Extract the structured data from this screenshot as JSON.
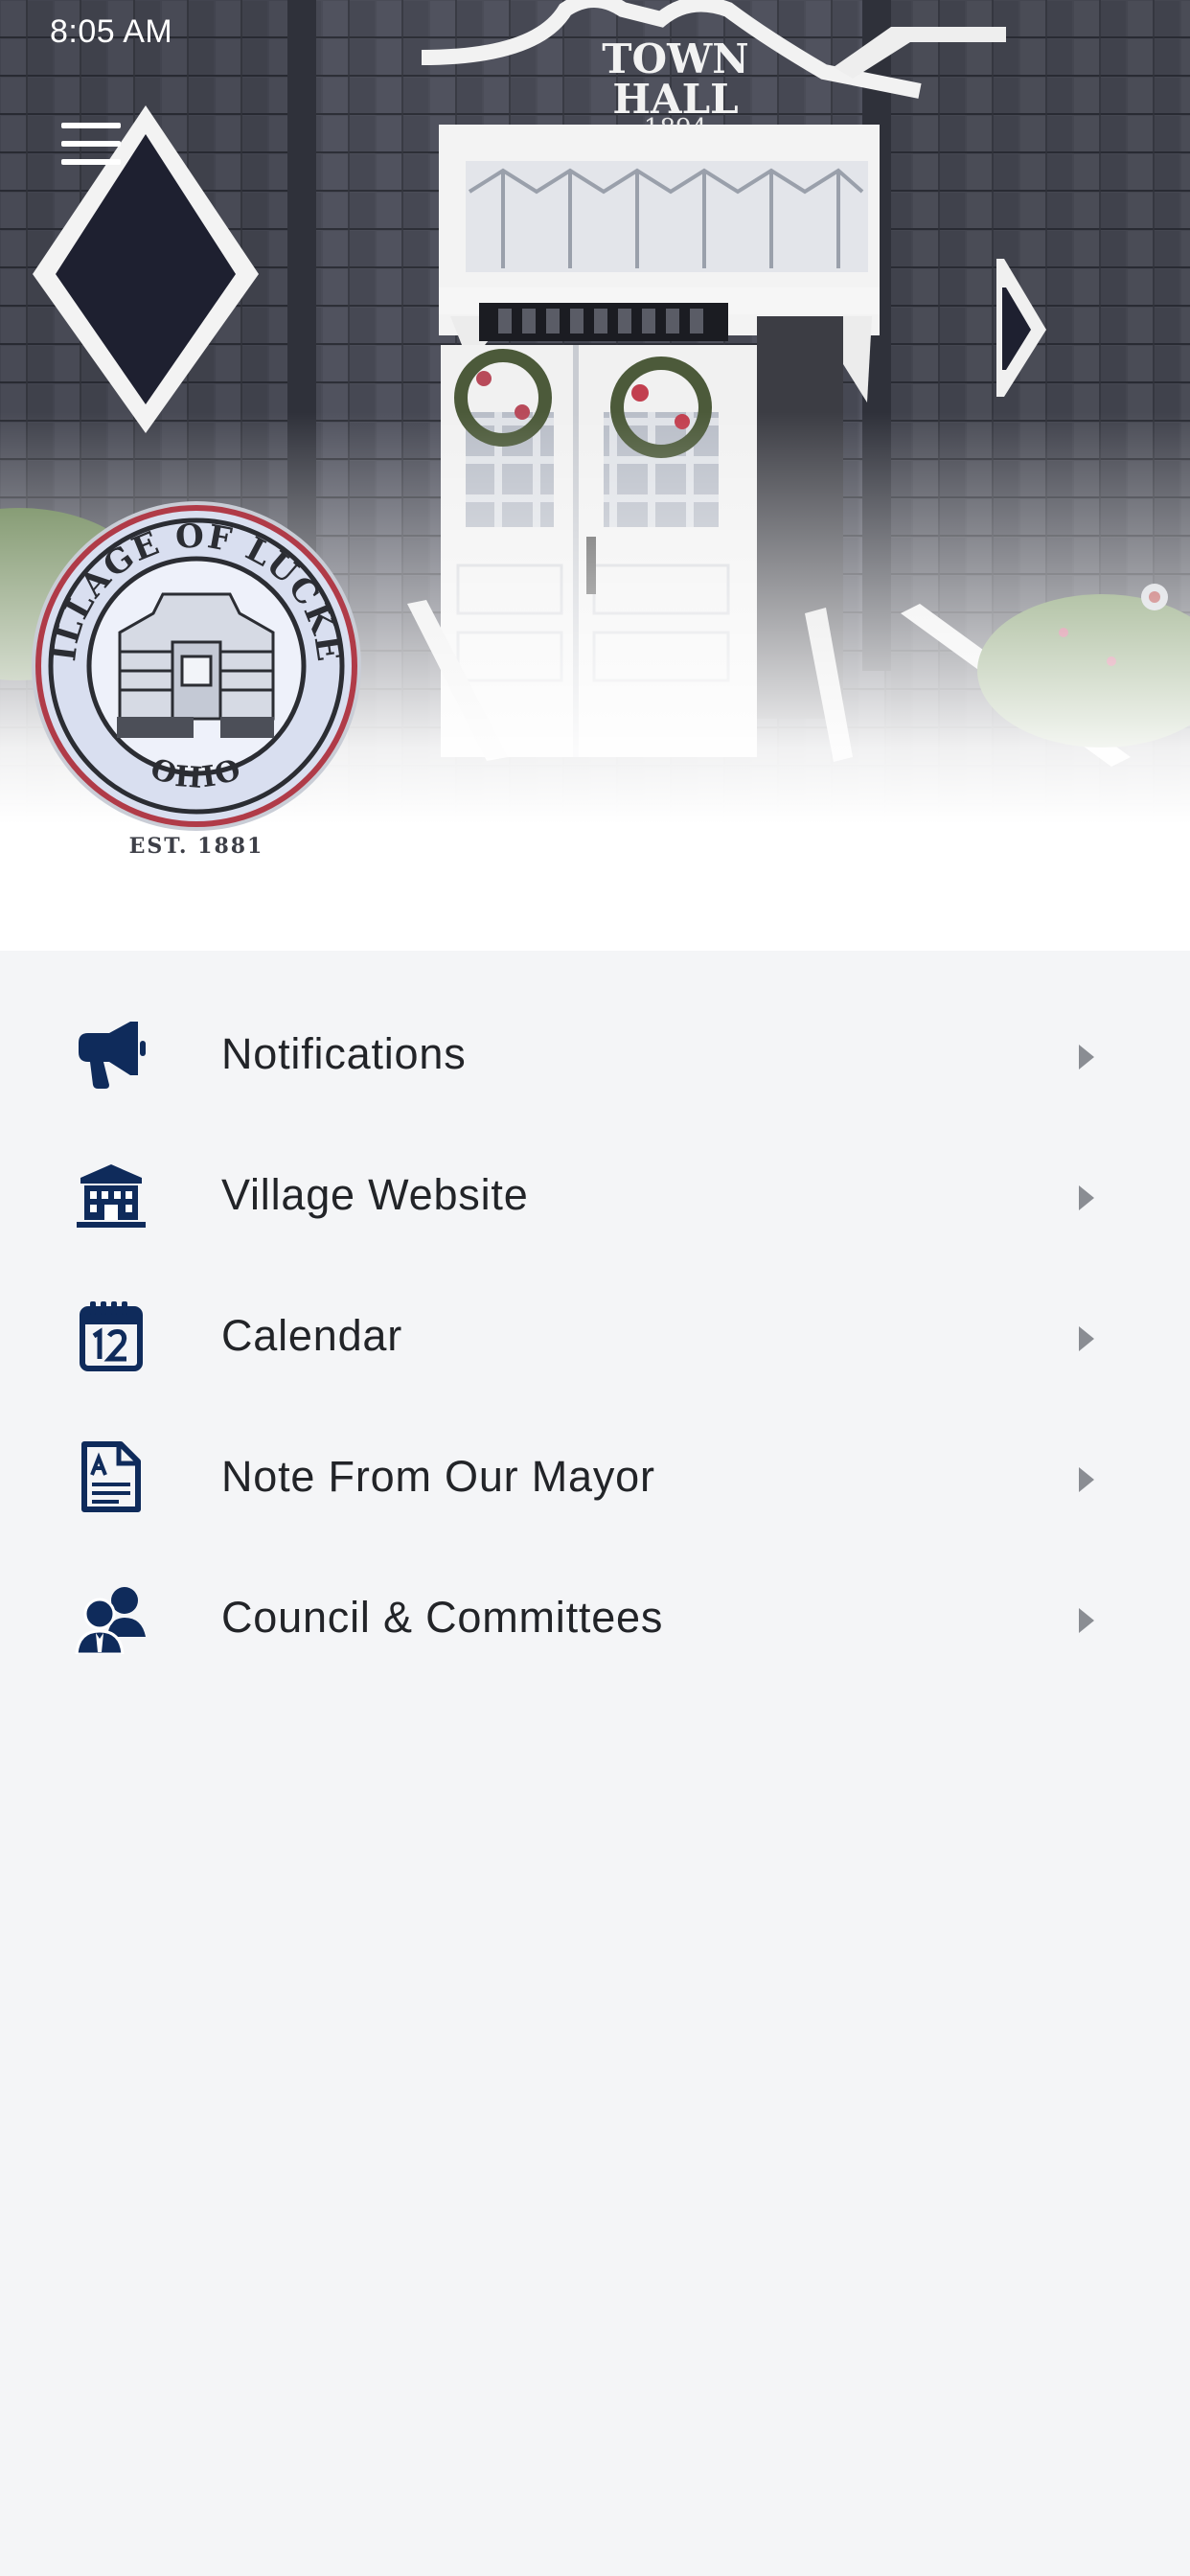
{
  "status_bar": {
    "time": "8:05 AM"
  },
  "header": {
    "menu_icon": "hamburger-menu-icon",
    "photo_sign_line1": "TOWN",
    "photo_sign_line2": "HALL",
    "photo_sign_year": "1894",
    "seal": {
      "top_text": "VILLAGE OF LUCKEY",
      "bottom_text": "OHIO",
      "established": "EST. 1881"
    }
  },
  "menu": {
    "items": [
      {
        "label": "Notifications",
        "icon": "megaphone-icon"
      },
      {
        "label": "Village Website",
        "icon": "building-icon"
      },
      {
        "label": "Calendar",
        "icon": "calendar-icon"
      },
      {
        "label": "Note From Our Mayor",
        "icon": "document-icon"
      },
      {
        "label": "Council & Committees",
        "icon": "people-icon"
      }
    ]
  },
  "colors": {
    "accent_navy": "#0f2b5b",
    "background": "#f4f5f7",
    "text": "#222428",
    "chevron": "#8a8d93"
  }
}
